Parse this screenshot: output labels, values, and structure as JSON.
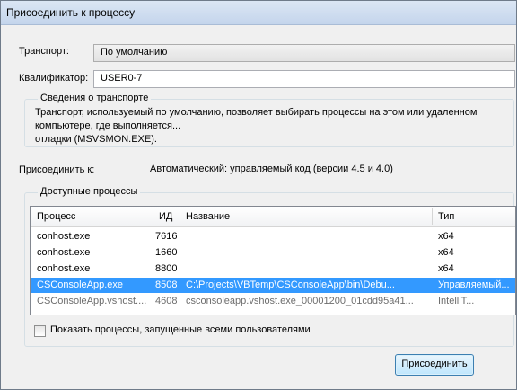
{
  "window": {
    "title": "Присоединить к процессу"
  },
  "transport": {
    "label": "Транспорт:",
    "value": "По умолчанию"
  },
  "qualifier": {
    "label": "Квалификатор:",
    "value": "USER0-7"
  },
  "transport_info": {
    "title": "Сведения о транспорте",
    "line1": "Транспорт, используемый по умолчанию, позволяет выбирать процессы на этом или удаленном",
    "line2": "компьютере, где выполняется...",
    "line3": "отладки (MSVSMON.EXE)."
  },
  "attach_to": {
    "label": "Присоединить к:",
    "value": "Автоматический: управляемый код (версии 4.5 и 4.0)"
  },
  "processes": {
    "title": "Доступные процессы",
    "columns": [
      "Процесс",
      "ИД",
      "Название",
      "Тип"
    ],
    "rows": [
      {
        "process": "conhost.exe",
        "id": "7616",
        "name": "",
        "type": "x64"
      },
      {
        "process": "conhost.exe",
        "id": "1660",
        "name": "",
        "type": "x64"
      },
      {
        "process": "conhost.exe",
        "id": "8800",
        "name": "",
        "type": "x64"
      },
      {
        "process": "CSConsoleApp.exe",
        "id": "8508",
        "name": "C:\\Projects\\VBTemp\\CSConsoleApp\\bin\\Debu...",
        "type": "Управляемый..."
      },
      {
        "process": "CSConsoleApp.vshost....",
        "id": "4608",
        "name": "csconsoleapp.vshost.exe_00001200_01cdd95a41...",
        "type": "IntelliT..."
      }
    ]
  },
  "show_all_users": {
    "label": "Показать процессы, запущенные всеми пользователями",
    "checked": false
  },
  "attach_button": {
    "label": "Присоединить"
  }
}
